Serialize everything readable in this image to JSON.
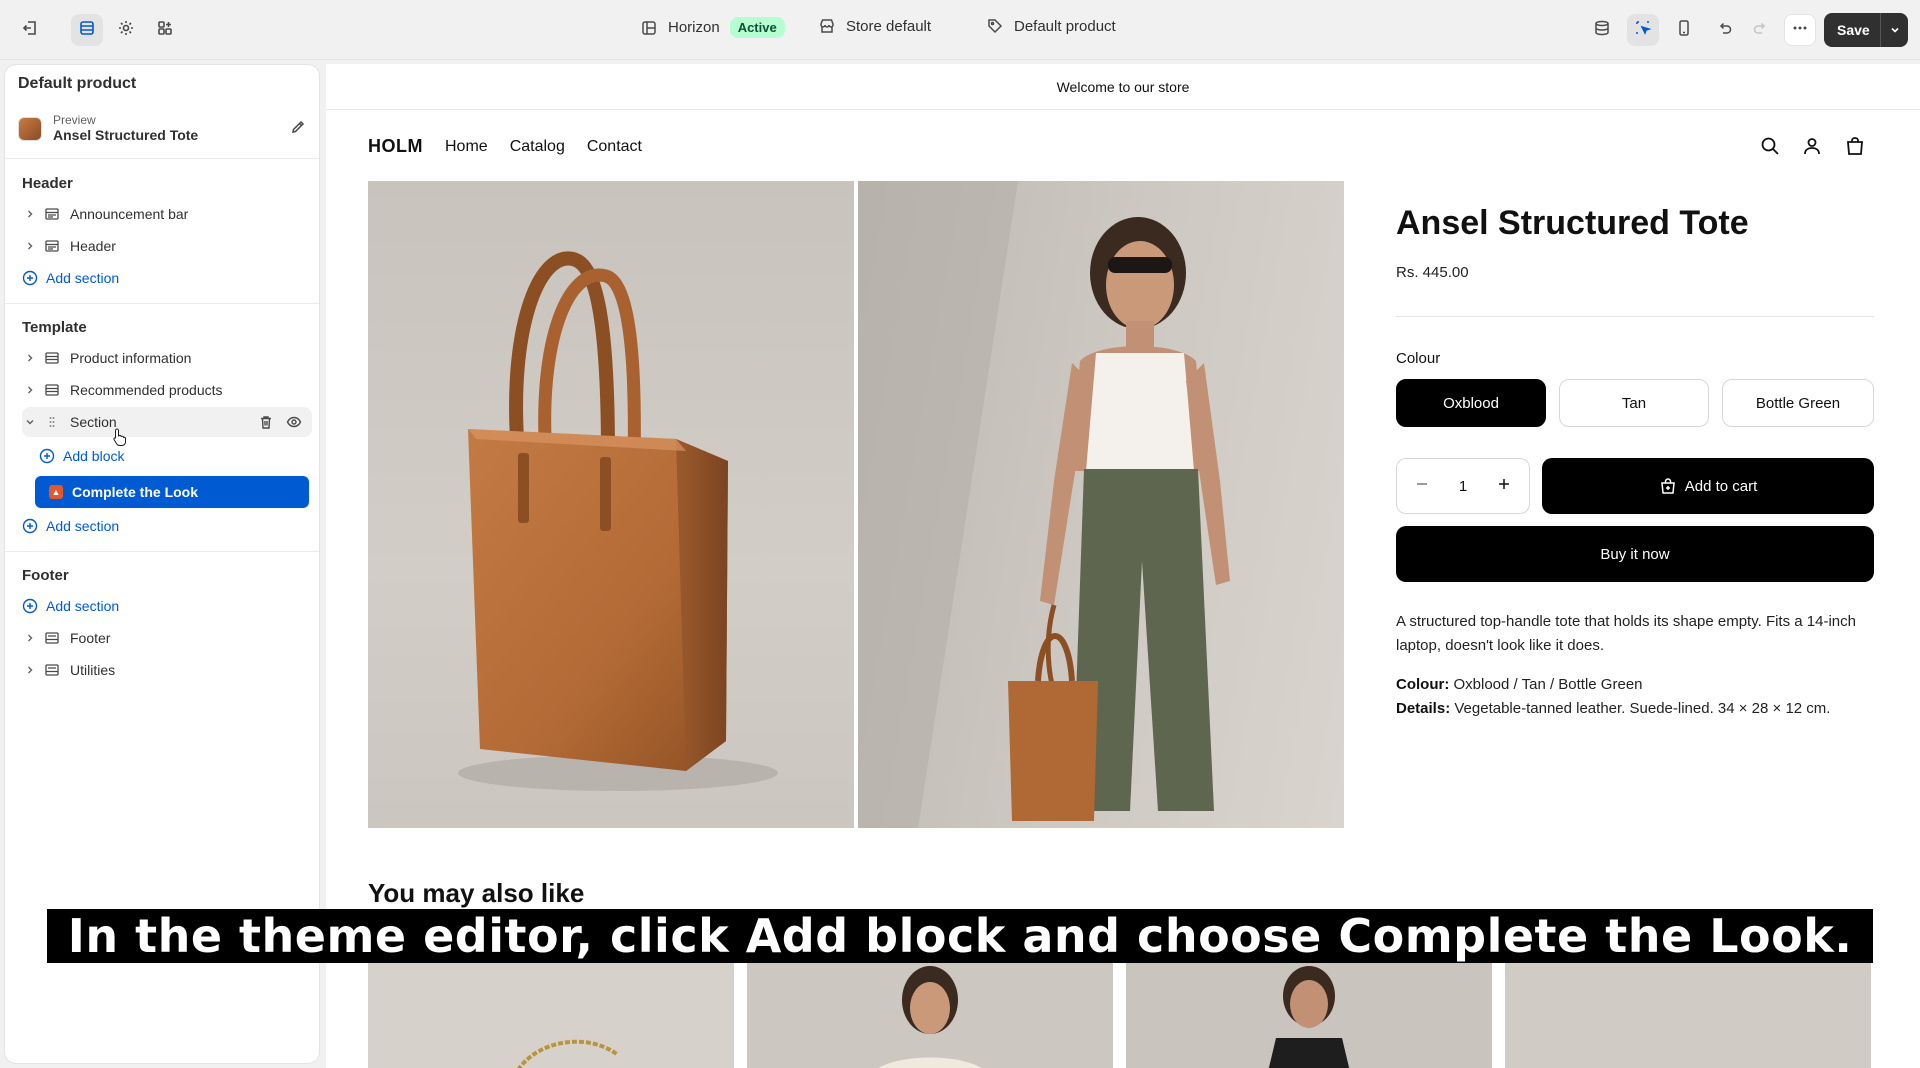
{
  "topbar": {
    "theme_name": "Horizon",
    "theme_status": "Active",
    "store_label": "Store default",
    "template_label": "Default product",
    "save_label": "Save",
    "accent_color": "#005bd3"
  },
  "sidebar": {
    "title": "Default product",
    "preview_small": "Preview",
    "preview_name": "Ansel Structured Tote",
    "header_group": "Header",
    "header_items": [
      "Announcement bar",
      "Header"
    ],
    "add_section": "Add section",
    "template_group": "Template",
    "template_items": [
      "Product information",
      "Recommended products",
      "Section"
    ],
    "add_block": "Add block",
    "selected_block": "Complete the Look",
    "footer_group": "Footer",
    "footer_items": [
      "Footer",
      "Utilities"
    ]
  },
  "store": {
    "announcement": "Welcome to our store",
    "logo": "HOLM",
    "nav": [
      "Home",
      "Catalog",
      "Contact"
    ]
  },
  "product": {
    "title": "Ansel Structured Tote",
    "price": "Rs. 445.00",
    "colour_label": "Colour",
    "colours": [
      "Oxblood",
      "Tan",
      "Bottle Green"
    ],
    "selected_colour": "Oxblood",
    "quantity": "1",
    "add_to_cart": "Add to cart",
    "buy_now": "Buy it now",
    "description": "A structured top-handle tote that holds its shape empty. Fits a 14-inch laptop, doesn't look like it does.",
    "colour_spec_label": "Colour:",
    "colour_spec_value": "Oxblood / Tan / Bottle Green",
    "details_label": "Details:",
    "details_value": "Vegetable-tanned leather. Suede-lined. 34 × 28 × 12 cm."
  },
  "recommendations": {
    "title": "You may also like"
  },
  "caption": "In the theme editor, click Add block and choose Complete the Look."
}
